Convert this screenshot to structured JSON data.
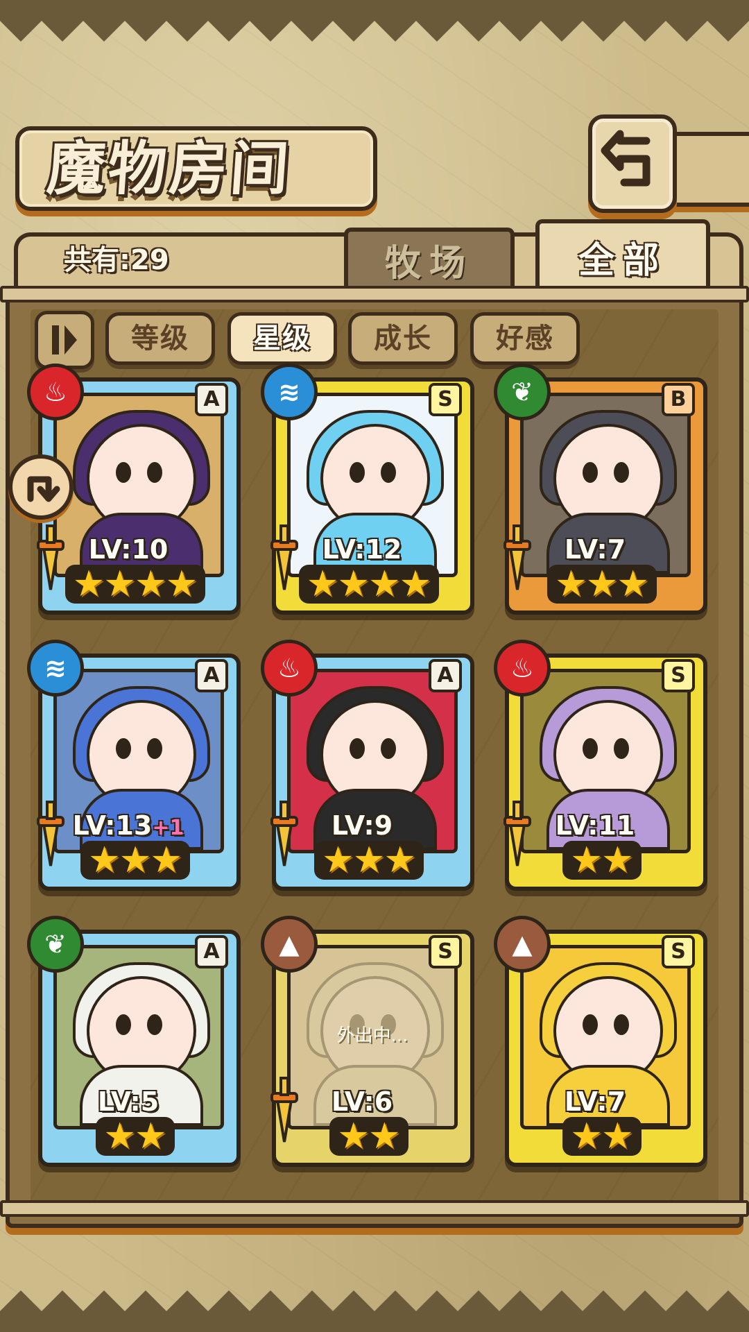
{
  "header": {
    "title": "魔物房间",
    "back_icon": "return-arrow-icon"
  },
  "collection": {
    "count_label": "共有:29"
  },
  "tabs": [
    {
      "label": "牧场",
      "active": false
    },
    {
      "label": "全部",
      "active": true
    }
  ],
  "sort_bar": {
    "toggle_icon": "sort-direction-icon",
    "buttons": [
      {
        "label": "等级",
        "active": false
      },
      {
        "label": "星级",
        "active": true
      },
      {
        "label": "成长",
        "active": false
      },
      {
        "label": "好感",
        "active": false
      }
    ]
  },
  "side_button": {
    "icon": "rotate-arrow-icon"
  },
  "monsters": [
    {
      "element": "fire",
      "element_icon": "fire-icon",
      "rank": "A",
      "level": "LV:10",
      "bonus": "",
      "stars": 4,
      "frame": "blue",
      "status": ""
    },
    {
      "element": "water",
      "element_icon": "water-waves-icon",
      "rank": "S",
      "level": "LV:12",
      "bonus": "",
      "stars": 4,
      "frame": "gold",
      "status": ""
    },
    {
      "element": "leaf",
      "element_icon": "leaf-icon",
      "rank": "B",
      "level": "LV:7",
      "bonus": "",
      "stars": 3,
      "frame": "bronze",
      "status": ""
    },
    {
      "element": "water",
      "element_icon": "water-waves-icon",
      "rank": "A",
      "level": "LV:13",
      "bonus": "+1",
      "stars": 3,
      "frame": "blue",
      "status": ""
    },
    {
      "element": "fire",
      "element_icon": "fire-icon",
      "rank": "A",
      "level": "LV:9",
      "bonus": "",
      "stars": 3,
      "frame": "blue",
      "status": ""
    },
    {
      "element": "fire",
      "element_icon": "fire-icon",
      "rank": "S",
      "level": "LV:11",
      "bonus": "",
      "stars": 2,
      "frame": "gold",
      "status": ""
    },
    {
      "element": "leaf",
      "element_icon": "leaf-icon",
      "rank": "A",
      "level": "LV:5",
      "bonus": "",
      "stars": 2,
      "frame": "blue",
      "status": ""
    },
    {
      "element": "earth",
      "element_icon": "earth-peak-icon",
      "rank": "S",
      "level": "LV:6",
      "bonus": "",
      "stars": 2,
      "frame": "out",
      "status": "外出中..."
    },
    {
      "element": "earth",
      "element_icon": "earth-peak-icon",
      "rank": "S",
      "level": "LV:7",
      "bonus": "",
      "stars": 2,
      "frame": "gold",
      "status": ""
    }
  ],
  "colors": {
    "frame_blue": "#8ed3ef",
    "frame_gold": "#f2dc3a",
    "frame_bronze": "#eb9a3b",
    "accent_orange": "#b46d1e",
    "outline": "#3d2c1c"
  }
}
